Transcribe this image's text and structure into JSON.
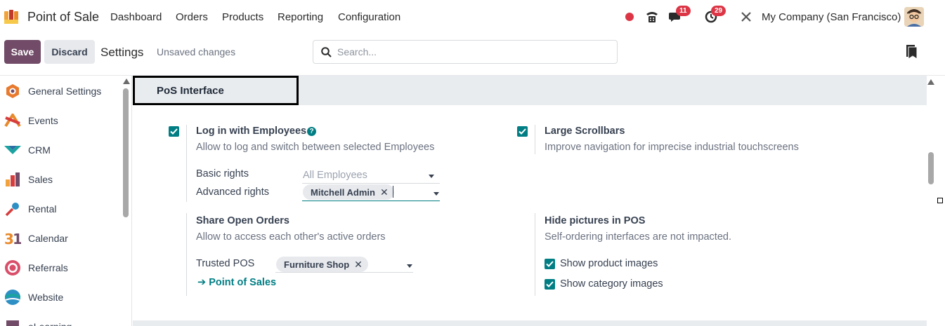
{
  "navbar": {
    "app_name": "Point of Sale",
    "menus": [
      "Dashboard",
      "Orders",
      "Products",
      "Reporting",
      "Configuration"
    ],
    "chat_badge": "11",
    "activity_badge": "29",
    "company": "My Company (San Francisco)"
  },
  "control_panel": {
    "save_label": "Save",
    "discard_label": "Discard",
    "breadcrumb": "Settings",
    "unsaved": "Unsaved changes",
    "search_placeholder": "Search..."
  },
  "sidebar": {
    "items": [
      {
        "label": "General Settings",
        "icon": "general-settings-icon"
      },
      {
        "label": "Events",
        "icon": "events-icon"
      },
      {
        "label": "CRM",
        "icon": "crm-icon"
      },
      {
        "label": "Sales",
        "icon": "sales-icon"
      },
      {
        "label": "Rental",
        "icon": "rental-icon"
      },
      {
        "label": "Calendar",
        "icon": "calendar-icon"
      },
      {
        "label": "Referrals",
        "icon": "referrals-icon"
      },
      {
        "label": "Website",
        "icon": "website-icon"
      },
      {
        "label": "eLearning",
        "icon": "elearning-icon"
      }
    ]
  },
  "section": {
    "title": "PoS Interface",
    "login_employees": {
      "title": "Log in with Employees",
      "checked": true,
      "desc": "Allow to log and switch between selected Employees",
      "basic_rights_label": "Basic rights",
      "basic_rights_placeholder": "All Employees",
      "advanced_rights_label": "Advanced rights",
      "advanced_rights_tag": "Mitchell Admin"
    },
    "large_scrollbars": {
      "title": "Large Scrollbars",
      "checked": true,
      "desc": "Improve navigation for imprecise industrial touchscreens"
    },
    "share_open_orders": {
      "title": "Share Open Orders",
      "desc": "Allow to access each other's active orders",
      "trusted_label": "Trusted POS",
      "trusted_tag": "Furniture Shop",
      "link": "Point of Sales"
    },
    "hide_pictures": {
      "title": "Hide pictures in POS",
      "desc": "Self-ordering interfaces are not impacted.",
      "show_product_images": "Show product images",
      "show_category_images": "Show category images"
    }
  },
  "colors": {
    "brand": "#714b67",
    "accent": "#017e84",
    "badge": "#dc3545"
  }
}
